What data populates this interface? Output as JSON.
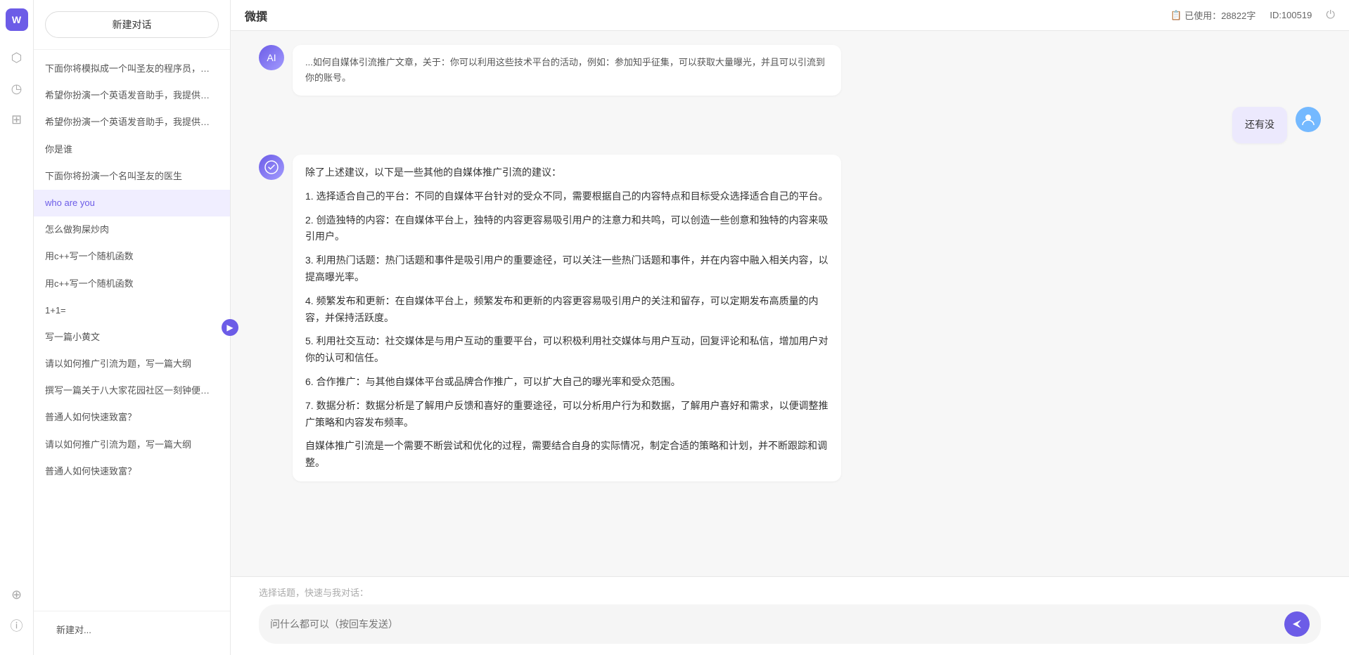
{
  "app": {
    "title": "微撰",
    "logo_text": "W"
  },
  "header": {
    "usage_label": "已使用：28822字",
    "usage_icon": "document-icon",
    "user_id": "ID:100519",
    "power_icon": "power-icon"
  },
  "sidebar": {
    "new_chat_label": "新建对话",
    "toggle_icon": "chevron-right-icon",
    "items": [
      {
        "id": 1,
        "text": "下面你将模拟成一个叫圣友的程序员，我说...",
        "active": false
      },
      {
        "id": 2,
        "text": "希望你扮演一个英语发音助手，我提供给你...",
        "active": false
      },
      {
        "id": 3,
        "text": "希望你扮演一个英语发音助手，我提供给你...",
        "active": false
      },
      {
        "id": 4,
        "text": "你是谁",
        "active": false
      },
      {
        "id": 5,
        "text": "下面你将扮演一个名叫圣友的医生",
        "active": false
      },
      {
        "id": 6,
        "text": "who are you",
        "active": true
      },
      {
        "id": 7,
        "text": "怎么做狗屎炒肉",
        "active": false
      },
      {
        "id": 8,
        "text": "用c++写一个随机函数",
        "active": false
      },
      {
        "id": 9,
        "text": "用c++写一个随机函数",
        "active": false
      },
      {
        "id": 10,
        "text": "1+1=",
        "active": false
      },
      {
        "id": 11,
        "text": "写一篇小黄文",
        "active": false
      },
      {
        "id": 12,
        "text": "请以如何推广引流为题，写一篇大纲",
        "active": false
      },
      {
        "id": 13,
        "text": "撰写一篇关于八大家花园社区一刻钟便民生...",
        "active": false
      },
      {
        "id": 14,
        "text": "普通人如何快速致富？",
        "active": false
      },
      {
        "id": 15,
        "text": "请以如何推广引流为题，写一篇大纲",
        "active": false
      },
      {
        "id": 16,
        "text": "普通人如何快速致富？",
        "active": false
      }
    ],
    "bottom_item": "新建对..."
  },
  "nav_icons": [
    {
      "name": "hexagon-icon",
      "symbol": "⬡",
      "active": false
    },
    {
      "name": "clock-icon",
      "symbol": "🕐",
      "active": false
    },
    {
      "name": "document-icon",
      "symbol": "📄",
      "active": false
    }
  ],
  "bottom_nav_icons": [
    {
      "name": "shield-icon",
      "symbol": "🛡",
      "active": false
    },
    {
      "name": "info-icon",
      "symbol": "ℹ",
      "active": false
    }
  ],
  "chat": {
    "messages": [
      {
        "id": 1,
        "role": "user",
        "text": "还有没",
        "avatar_type": "user"
      },
      {
        "id": 2,
        "role": "ai",
        "paragraphs": [
          "除了上述建议，以下是一些其他的自媒体推广引流的建议：",
          "1. 选择适合自己的平台：不同的自媒体平台针对的受众不同，需要根据自己的内容特点和目标受众选择适合自己的平台。",
          "2. 创造独特的内容：在自媒体平台上，独特的内容更容易吸引用户的注意力和共鸣，可以创造一些创意和独特的内容来吸引用户。",
          "3. 利用热门话题：热门话题和事件是吸引用户的重要途径，可以关注一些热门话题和事件，并在内容中融入相关内容，以提高曝光率。",
          "4. 频繁发布和更新：在自媒体平台上，频繁发布和更新的内容更容易吸引用户的关注和留存，可以定期发布高质量的内容，并保持活跃度。",
          "5. 利用社交互动：社交媒体是与用户互动的重要平台，可以积极利用社交媒体与用户互动，回复评论和私信，增加用户对你的认可和信任。",
          "6. 合作推广：与其他自媒体平台或品牌合作推广，可以扩大自己的曝光率和受众范围。",
          "7. 数据分析：数据分析是了解用户反馈和喜好的重要途径，可以分析用户行为和数据，了解用户喜好和需求，以便调整推广策略和内容发布频率。",
          "自媒体推广引流是一个需要不断尝试和优化的过程，需要结合自身的实际情况，制定合适的策略和计划，并不断跟踪和调整。"
        ],
        "avatar_type": "ai"
      }
    ],
    "quick_topics_label": "选择话题，快速与我对话：",
    "input_placeholder": "问什么都可以（按回车发送）",
    "send_icon": "send-icon"
  }
}
